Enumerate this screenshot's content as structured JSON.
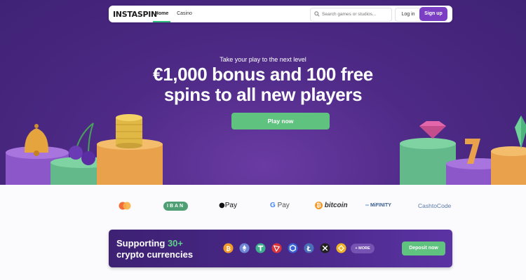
{
  "header": {
    "logo_text": "INSTASPIN",
    "tabs": [
      {
        "label": "Home"
      },
      {
        "label": "Casino"
      }
    ],
    "search": {
      "placeholder": "Search games or studios..."
    },
    "login_label": "Log in",
    "signup_label": "Sign up"
  },
  "hero": {
    "tagline": "Take your play to the next level",
    "headline_line1": "€1,000 bonus and 100 free",
    "headline_line2": "spins to all new players",
    "cta_label": "Play now"
  },
  "payments": {
    "iban": "IBAN",
    "applepay": "Pay",
    "googlepay": "Pay",
    "bitcoin": "bitcoin",
    "mifinity": "MiFINITY",
    "cashtocode": "CashtoCode"
  },
  "crypto": {
    "title_prefix": "Supporting ",
    "title_highlight": "30+",
    "title_line2": "crypto currencies",
    "coins": [
      "bitcoin-icon",
      "ethereum-icon",
      "tether-icon",
      "tron-icon",
      "chainlink-icon",
      "litecoin-icon",
      "xrp-icon",
      "bnb-icon"
    ],
    "more_label": "+ MORE",
    "deposit_label": "Deposit now"
  },
  "colors": {
    "accent_purple": "#7b3fc4",
    "green_cta": "#5fc27e",
    "hero_bg": "#4e2a86"
  }
}
